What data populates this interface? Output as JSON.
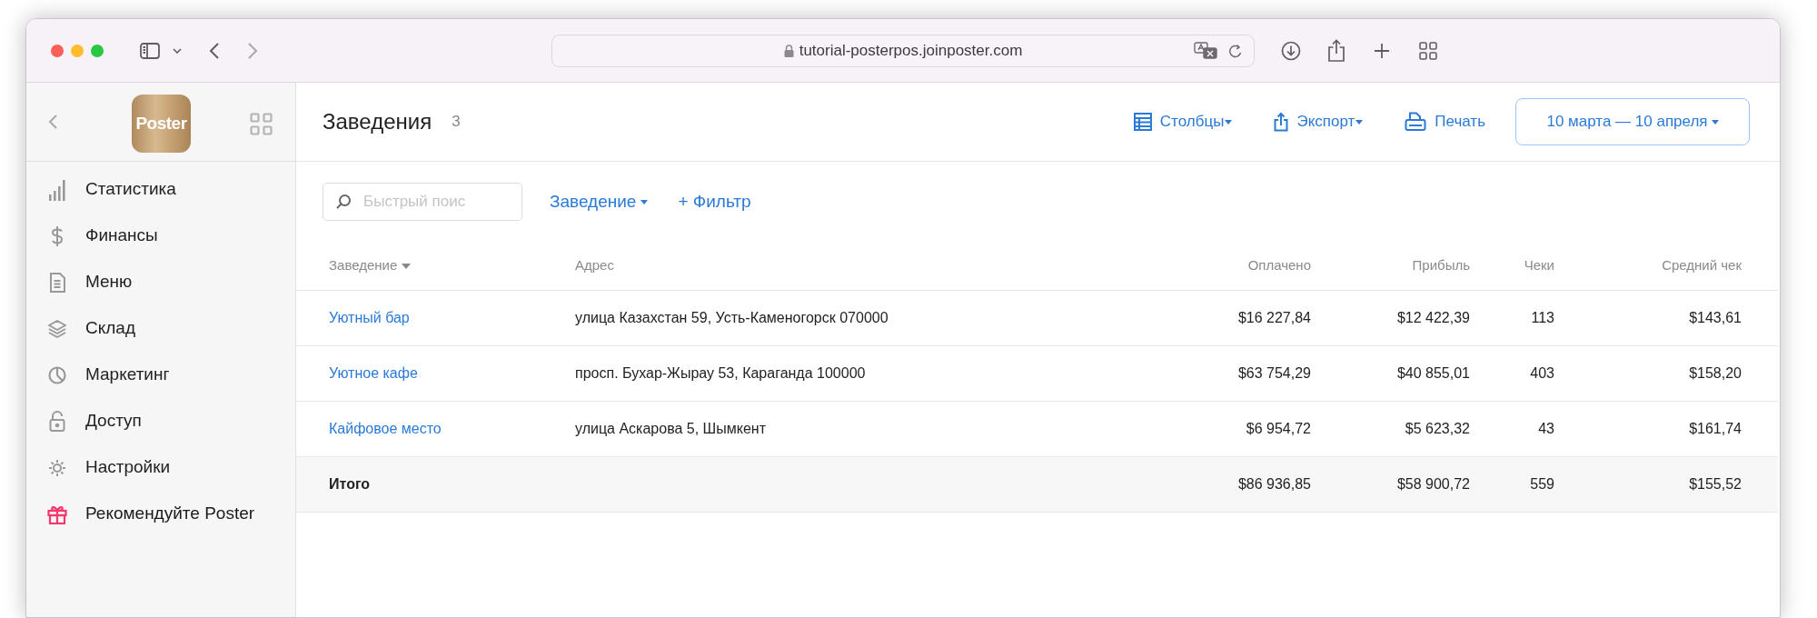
{
  "browser": {
    "url": "tutorial-posterpos.joinposter.com"
  },
  "sidebar": {
    "logo": "Poster",
    "items": [
      {
        "label": "Статистика",
        "kind": "nav"
      },
      {
        "label": "Финансы",
        "kind": "nav"
      },
      {
        "label": "Меню",
        "kind": "nav"
      },
      {
        "label": "Склад",
        "kind": "nav"
      },
      {
        "label": "Маркетинг",
        "kind": "nav"
      },
      {
        "label": "Доступ",
        "kind": "nav"
      },
      {
        "label": "Настройки",
        "kind": "nav"
      },
      {
        "label": "Рекомендуйте Poster",
        "kind": "promo"
      }
    ]
  },
  "header": {
    "title": "Заведения",
    "count": "3",
    "actions": [
      {
        "label": "Столбцы",
        "kind": "columns"
      },
      {
        "label": "Экспорт",
        "kind": "export"
      },
      {
        "label": "Печать",
        "kind": "print"
      }
    ],
    "date_range": "10 марта — 10 апреля"
  },
  "filters": {
    "search": {
      "placeholder": "Быстрый поис"
    },
    "dropdown": "Заведение",
    "add_filter": "+ Фильтр"
  },
  "table": {
    "columns": [
      {
        "label": "Заведение",
        "sorted": true
      },
      {
        "label": "Адрес",
        "sorted": false
      },
      {
        "label": "Оплачено",
        "sorted": false
      },
      {
        "label": "Прибыль",
        "sorted": false
      },
      {
        "label": "Чеки",
        "sorted": false
      },
      {
        "label": "Средний чек",
        "sorted": false
      }
    ],
    "rows": [
      {
        "kind": "item",
        "cells": [
          "Уютный бар",
          "улица Казахстан 59, Усть-Каменогорск 070000",
          "$16 227,84",
          "$12 422,39",
          "113",
          "$143,61"
        ]
      },
      {
        "kind": "item",
        "cells": [
          "Уютное кафе",
          "просп. Бухар-Жырау 53, Караганда 100000",
          "$63 754,29",
          "$40 855,01",
          "403",
          "$158,20"
        ]
      },
      {
        "kind": "item",
        "cells": [
          "Кайфовое место",
          "улица Аскарова 5, Шымкент",
          "$6 954,72",
          "$5 623,32",
          "43",
          "$161,74"
        ]
      },
      {
        "kind": "total",
        "cells": [
          "Итого",
          "",
          "$86 936,85",
          "$58 900,72",
          "559",
          "$155,52"
        ]
      }
    ]
  }
}
